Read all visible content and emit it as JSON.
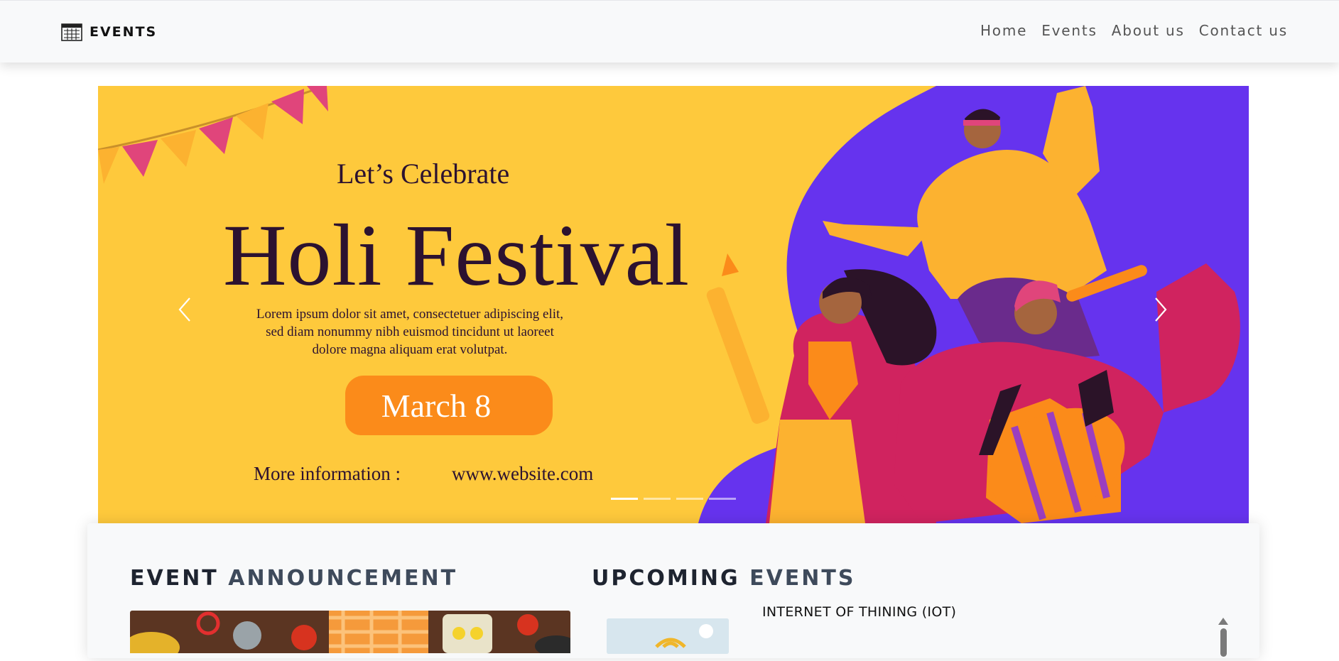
{
  "navbar": {
    "brand": "EVENTS",
    "brand_icon": "calendar-grid-icon",
    "links": [
      "Home",
      "Events",
      "About us",
      "Contact us"
    ]
  },
  "carousel": {
    "slide": {
      "tagline": "Let’s Celebrate",
      "headline": "Holi Festival",
      "description": "Lorem ipsum dolor sit amet, consectetuer adipiscing elit, sed diam nonummy nibh euismod tincidunt ut laoreet dolore magna aliquam erat volutpat.",
      "date": "March 8",
      "more_info_label": "More information :",
      "website": "www.website.com"
    },
    "prev_icon": "chevron-left-icon",
    "next_icon": "chevron-right-icon",
    "indicator_count": 4,
    "active_indicator": 0,
    "colors": {
      "background": "#fec93c",
      "purple": "#6633ee",
      "pink": "#e0457b",
      "orange": "#fb8b1a",
      "text": "#2c1230"
    }
  },
  "announcements": {
    "title_strong": "EVENT",
    "title_light": "ANNOUNCEMENT"
  },
  "upcoming": {
    "title_strong": "UPCOMING",
    "title_light": "EVENTS",
    "items": [
      {
        "title": "INTERNET OF THINING (IOT)"
      }
    ]
  }
}
